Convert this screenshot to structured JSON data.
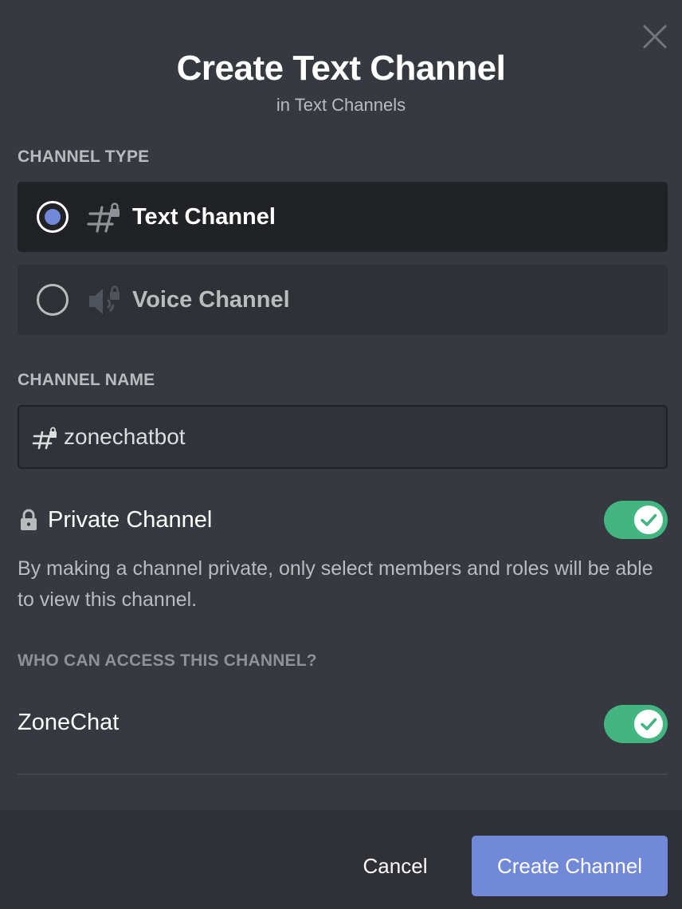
{
  "dialog": {
    "title": "Create Text Channel",
    "subtitle": "in Text Channels",
    "close_icon": "close-icon"
  },
  "channel_type": {
    "label": "CHANNEL TYPE",
    "options": [
      {
        "label": "Text Channel",
        "icon": "hash-lock-icon",
        "selected": true
      },
      {
        "label": "Voice Channel",
        "icon": "speaker-lock-icon",
        "selected": false
      }
    ]
  },
  "channel_name": {
    "label": "CHANNEL NAME",
    "value": "zonechatbot",
    "icon": "hash-lock-icon"
  },
  "private_channel": {
    "icon": "lock-icon",
    "label": "Private Channel",
    "enabled": true,
    "description": "By making a channel private, only select members and roles will be able to view this channel."
  },
  "access": {
    "label": "WHO CAN ACCESS THIS CHANNEL?",
    "roles": [
      {
        "name": "ZoneChat",
        "enabled": true
      }
    ]
  },
  "footer": {
    "cancel_label": "Cancel",
    "create_label": "Create Channel"
  },
  "colors": {
    "background": "#36393f",
    "accent": "#7289da",
    "toggle_on": "#43b581",
    "footer": "#2f3136"
  }
}
